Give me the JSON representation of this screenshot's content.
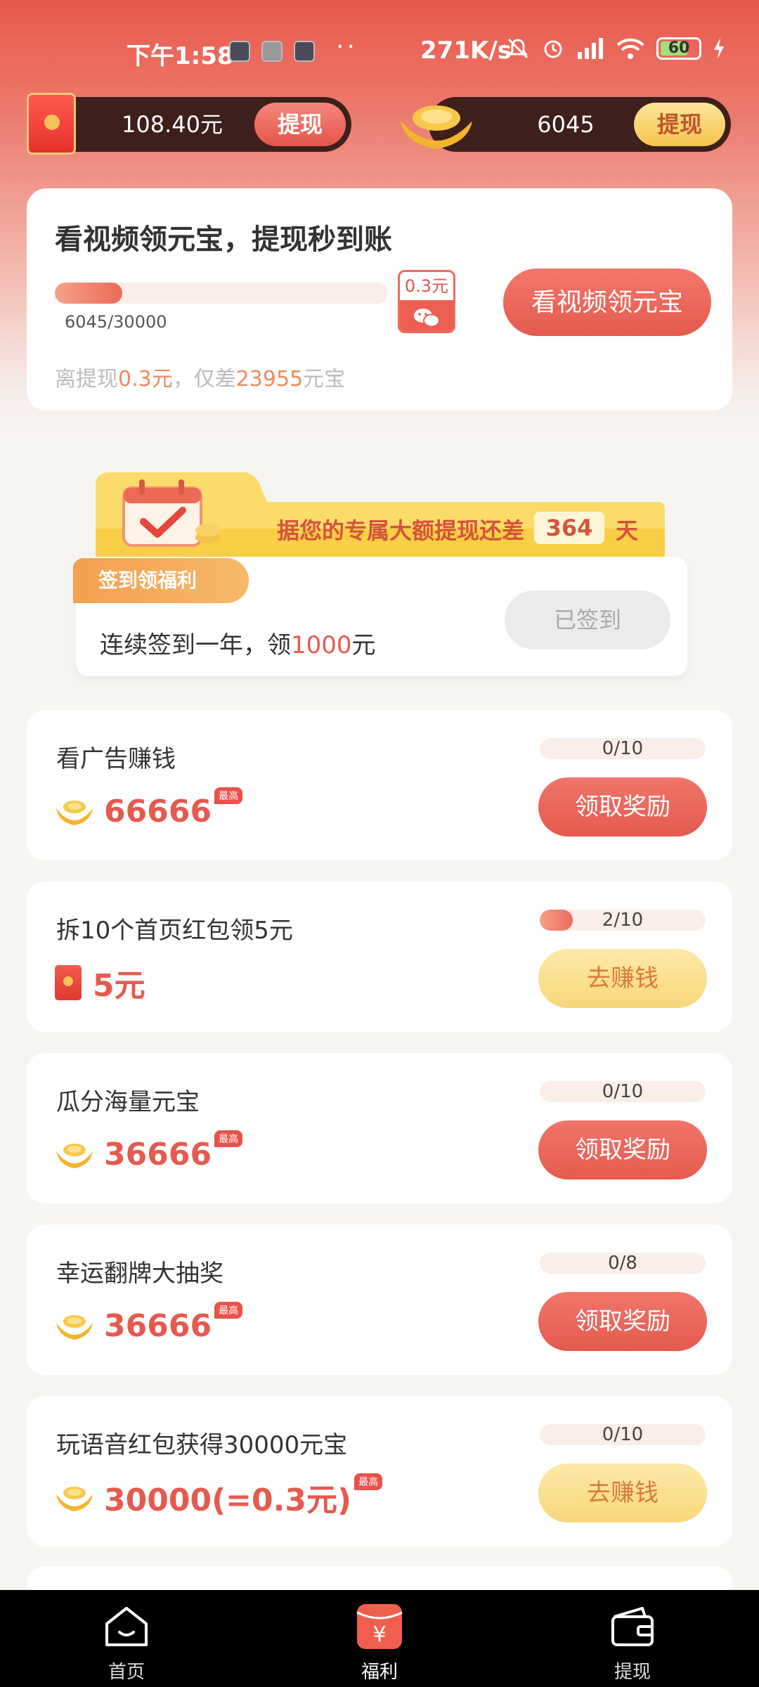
{
  "status_bar": {
    "time": "下午1:58",
    "dots": "··",
    "net_speed": "271K/s",
    "battery": "60"
  },
  "top_balance": {
    "cash_value": "108.40元",
    "cash_withdraw_label": "提现",
    "ingot_value": "6045",
    "ingot_withdraw_label": "提现"
  },
  "video_card": {
    "title": "看视频领元宝，提现秒到账",
    "progress_text": "6045/30000",
    "progress_fraction": 0.2015,
    "badge_amount": "0.3元",
    "note_prefix": "离提现",
    "note_amount": "0.3元",
    "note_middle": "，仅差",
    "note_remaining": "23955",
    "note_suffix": "元宝",
    "button_label": "看视频领元宝"
  },
  "checkin": {
    "banner_text": "据您的专属大额提现还差",
    "banner_days": "364",
    "banner_unit": "天",
    "tag_label": "签到领福利",
    "desc_prefix": "连续签到一年，领",
    "desc_amount": "1000",
    "desc_suffix": "元",
    "button_label": "已签到"
  },
  "tasks": [
    {
      "title": "看广告赚钱",
      "reward": "66666",
      "max_tag": "最高",
      "progress_text": "0/10",
      "progress_fraction": 0,
      "button": "领取奖励"
    },
    {
      "title": "拆10个首页红包领5元",
      "reward": "5元",
      "max_tag": "",
      "progress_text": "2/10",
      "progress_fraction": 0.2,
      "button": "去赚钱"
    },
    {
      "title": "瓜分海量元宝",
      "reward": "36666",
      "max_tag": "最高",
      "progress_text": "0/10",
      "progress_fraction": 0,
      "button": "领取奖励"
    },
    {
      "title": "幸运翻牌大抽奖",
      "reward": "36666",
      "max_tag": "最高",
      "progress_text": "0/8",
      "progress_fraction": 0,
      "button": "领取奖励"
    },
    {
      "title": "玩语音红包获得30000元宝",
      "reward": "30000(=0.3元)",
      "max_tag": "最高",
      "progress_text": "0/10",
      "progress_fraction": 0,
      "button": "去赚钱"
    }
  ],
  "bottom_nav": {
    "home": "首页",
    "welfare": "福利",
    "withdraw": "提现",
    "welfare_icon_glyph": "¥"
  },
  "colors": {
    "accent_red": "#e55a4e",
    "accent_gold": "#f8d67a",
    "header_red": "#e9584c"
  }
}
